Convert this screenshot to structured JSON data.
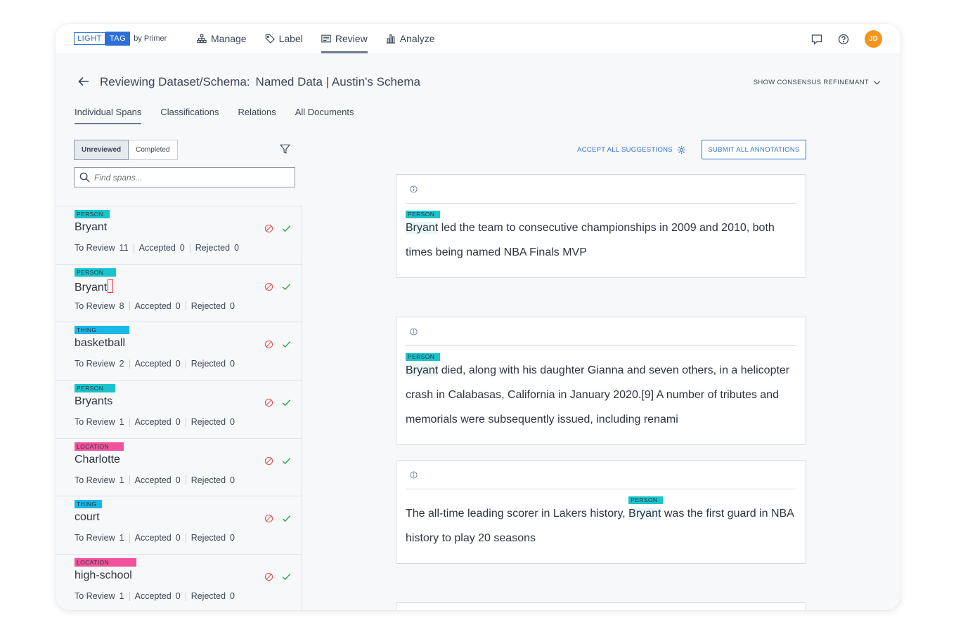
{
  "logo": {
    "light": "LIGHT",
    "tag": "TAG",
    "by": "by Primer"
  },
  "nav": [
    {
      "label": "Manage",
      "icon": "hierarchy-icon"
    },
    {
      "label": "Label",
      "icon": "tag-icon"
    },
    {
      "label": "Review",
      "icon": "review-icon"
    },
    {
      "label": "Analyze",
      "icon": "bar-chart-icon"
    }
  ],
  "header": {
    "avatar": "JD"
  },
  "title": {
    "prefix": "Reviewing Dataset/Schema:",
    "dataset": "Named Data | Austin's Schema"
  },
  "consensus": "SHOW CONSENSUS REFINEMANT",
  "tabs": [
    "Individual Spans",
    "Classifications",
    "Relations",
    "All Documents"
  ],
  "segment": {
    "unreviewed": "Unreviewed",
    "completed": "Completed"
  },
  "search": {
    "placeholder": "Find spans..."
  },
  "colors": {
    "person": "#19c5cc",
    "thing": "#19b8e6",
    "location": "#f0529c",
    "accent": "#2d6fd6",
    "reject": "#e55353",
    "accept": "#2fa84f"
  },
  "stat_labels": {
    "to_review": "To Review",
    "accepted": "Accepted",
    "rejected": "Rejected"
  },
  "spans": [
    {
      "label": "PERSON",
      "text": "Bryant",
      "to_review": "11",
      "accepted": "0",
      "rejected": "0"
    },
    {
      "label": "PERSON",
      "text": "Bryant",
      "to_review": "8",
      "accepted": "0",
      "rejected": "0"
    },
    {
      "label": "THING",
      "text": "basketball",
      "to_review": "2",
      "accepted": "0",
      "rejected": "0"
    },
    {
      "label": "PERSON",
      "text": "Bryants",
      "to_review": "1",
      "accepted": "0",
      "rejected": "0"
    },
    {
      "label": "LOCATION",
      "text": "Charlotte",
      "to_review": "1",
      "accepted": "0",
      "rejected": "0"
    },
    {
      "label": "THING",
      "text": "court",
      "to_review": "1",
      "accepted": "0",
      "rejected": "0"
    },
    {
      "label": "LOCATION",
      "text": "high-school",
      "to_review": "1",
      "accepted": "0",
      "rejected": "0"
    }
  ],
  "actions": {
    "accept_all": "ACCEPT ALL SUGGESTIONS",
    "submit_all": "SUBMIT ALL ANNOTATIONS"
  },
  "documents": [
    {
      "entity_label": "PERSON",
      "entity": "Bryant",
      "before": "",
      "after": " led the team to consecutive championships in 2009 and 2010, both times being named NBA Finals MVP"
    },
    {
      "entity_label": "PERSON",
      "entity": "Bryant",
      "before": "",
      "after": " died, along with his daughter Gianna and seven others, in a helicopter crash in Calabasas, California in January 2020.[9] A number of tributes and memorials were subsequently issued, including renami"
    },
    {
      "entity_label": "PERSON",
      "entity": "Bryant",
      "before": "The all-time leading scorer in Lakers history, ",
      "after": " was the first guard in NBA history to play 20 seasons"
    }
  ]
}
